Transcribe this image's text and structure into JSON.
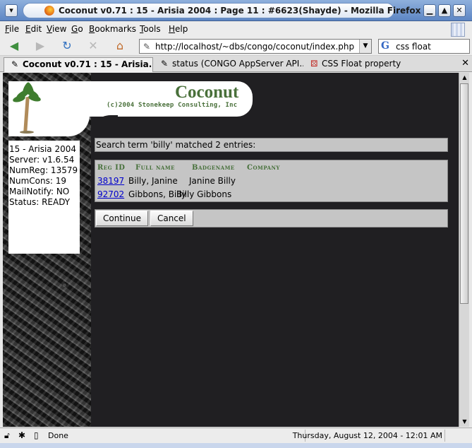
{
  "window": {
    "title": "Coconut v0.71 : 15 - Arisia 2004 : Page 11 : #6623(Shayde) - Mozilla Firefox",
    "menu_icon": "down-arrow-icon",
    "controls": [
      "minimize-icon",
      "maximize-icon",
      "close-icon"
    ]
  },
  "menu": [
    "File",
    "Edit",
    "View",
    "Go",
    "Bookmarks",
    "Tools",
    "Help"
  ],
  "nav": {
    "url": "http://localhost/~dbs/congo/coconut/index.php",
    "search_value": "css float",
    "buttons": [
      "back-icon",
      "forward-icon",
      "reload-icon",
      "stop-icon",
      "home-icon"
    ]
  },
  "tabs": [
    {
      "label": "Coconut v0.71 : 15 - Arisia...",
      "active": true,
      "icon": "page-icon"
    },
    {
      "label": "status (CONGO AppServer API...",
      "active": false,
      "icon": "page-icon"
    },
    {
      "label": "CSS Float property",
      "active": false,
      "icon": "dice-icon"
    }
  ],
  "brand": {
    "name": "Coconut",
    "subtitle": "(c)2004 Stonekeep Consulting, Inc"
  },
  "status_panel": {
    "con": "15 - Arisia 2004",
    "server": "Server: v1.6.54",
    "numreg": "NumReg: 13579",
    "numcons": "NumCons: 19",
    "mailnotify": "MailNotify: NO",
    "status": "Status: READY"
  },
  "search": {
    "message": "Search term 'billy' matched 2 entries:"
  },
  "results": {
    "headers": [
      "Reg ID",
      "Full name",
      "Badgename",
      "Company"
    ],
    "rows": [
      {
        "reg_id": "38197",
        "full_name": "Billy, Janine",
        "badgename": "Janine Billy",
        "company": ""
      },
      {
        "reg_id": "92702",
        "full_name": "Gibbons, Billy",
        "badgename": "Billy Gibbons",
        "company": ""
      }
    ]
  },
  "actions": {
    "continue": "Continue",
    "cancel": "Cancel"
  },
  "statusbar": {
    "text": "Done",
    "datetime": "Thursday, August 12, 2004 - 12:01 AM"
  },
  "colors": {
    "page_background": "#201f22",
    "brand_green": "#49703a",
    "panel_gray": "#c5c5c5",
    "link_blue": "#0000cc"
  }
}
